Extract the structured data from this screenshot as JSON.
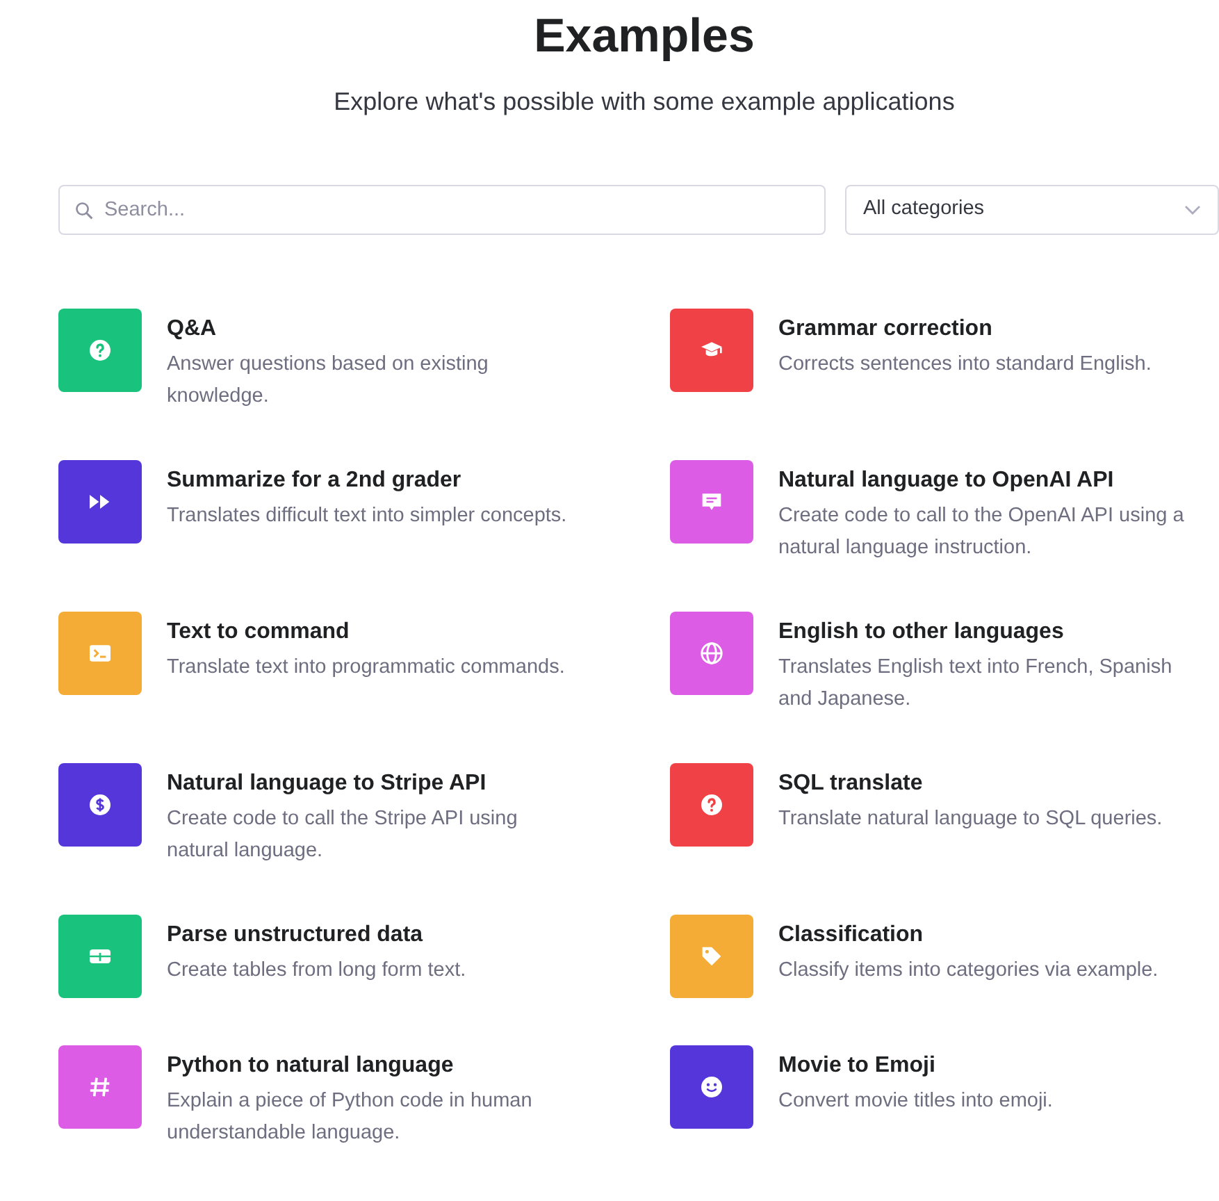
{
  "header": {
    "title": "Examples",
    "subtitle": "Explore what's possible with some example applications"
  },
  "search": {
    "placeholder": "Search..."
  },
  "category_select": {
    "value": "All categories"
  },
  "examples": [
    {
      "title": "Q&A",
      "description": "Answer questions based on existing knowledge.",
      "kind": "question",
      "color": "#19c37d"
    },
    {
      "title": "Grammar correction",
      "description": "Corrects sentences into standard English.",
      "kind": "cap",
      "color": "#ef4146"
    },
    {
      "title": "Summarize for a 2nd grader",
      "description": "Translates difficult text into simpler concepts.",
      "kind": "forward",
      "color": "#5436da"
    },
    {
      "title": "Natural language to OpenAI API",
      "description": "Create code to call to the OpenAI API using a natural language instruction.",
      "kind": "message",
      "color": "#dd5ce5"
    },
    {
      "title": "Text to command",
      "description": "Translate text into programmatic commands.",
      "kind": "terminal",
      "color": "#f4ac36"
    },
    {
      "title": "English to other languages",
      "description": "Translates English text into French, Spanish and Japanese.",
      "kind": "globe",
      "color": "#dd5ce5"
    },
    {
      "title": "Natural language to Stripe API",
      "description": "Create code to call the Stripe API using natural language.",
      "kind": "dollar",
      "color": "#5436da"
    },
    {
      "title": "SQL translate",
      "description": "Translate natural language to SQL queries.",
      "kind": "question",
      "color": "#ef4146"
    },
    {
      "title": "Parse unstructured data",
      "description": "Create tables from long form text.",
      "kind": "table",
      "color": "#19c37d"
    },
    {
      "title": "Classification",
      "description": "Classify items into categories via example.",
      "kind": "tag",
      "color": "#f4ac36"
    },
    {
      "title": "Python to natural language",
      "description": "Explain a piece of Python code in human understandable language.",
      "kind": "hash",
      "color": "#dd5ce5"
    },
    {
      "title": "Movie to Emoji",
      "description": "Convert movie titles into emoji.",
      "kind": "smile",
      "color": "#5436da"
    }
  ]
}
